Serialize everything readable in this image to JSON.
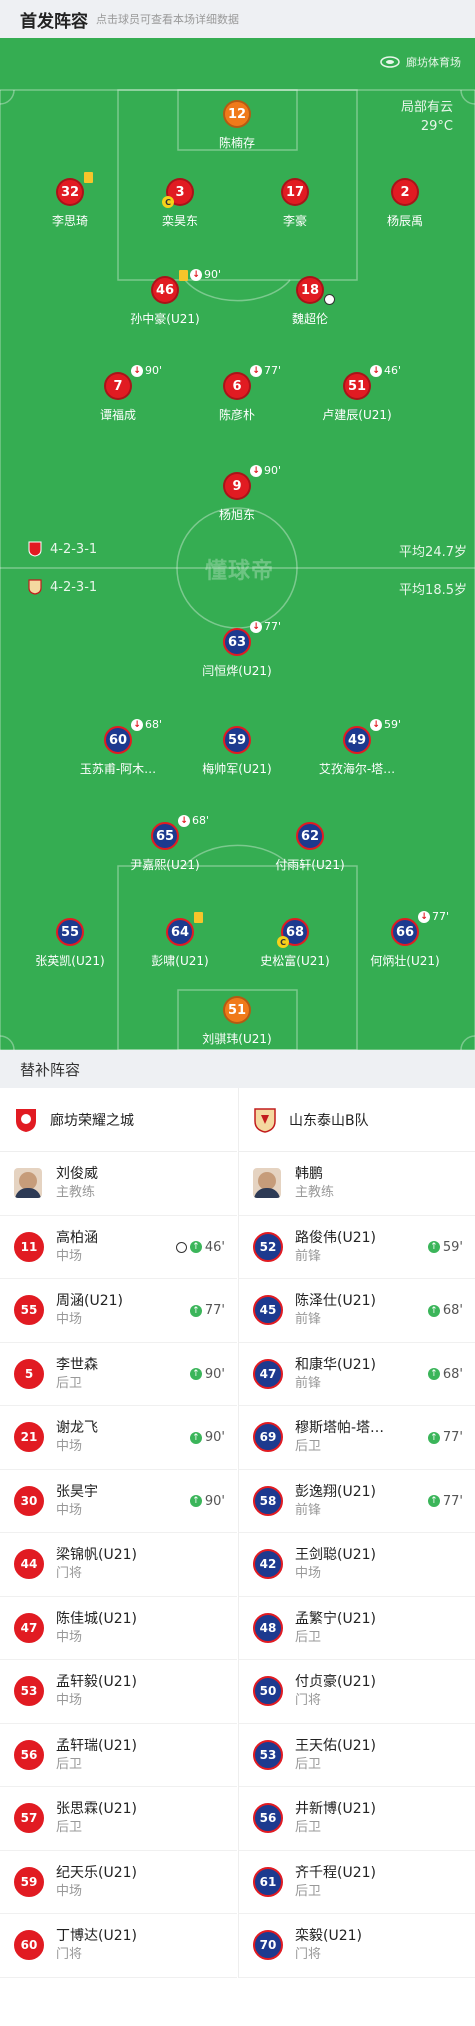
{
  "header": {
    "title": "首发阵容",
    "subtitle": "点击球员可查看本场详细数据"
  },
  "venue": "廊坊体育场",
  "weather": {
    "condition": "局部有云",
    "temp": "29°C"
  },
  "home": {
    "formation": "4-2-3-1",
    "avg_age": "平均24.7岁"
  },
  "away": {
    "formation": "4-2-3-1",
    "avg_age": "平均18.5岁"
  },
  "watermark": "懂球帝",
  "home_players": [
    {
      "num": "12",
      "name": "陈楠存",
      "color": "orange"
    },
    {
      "num": "32",
      "name": "李思琦",
      "color": "red",
      "yellow": true
    },
    {
      "num": "3",
      "name": "栾昊东",
      "color": "red",
      "captain": true
    },
    {
      "num": "17",
      "name": "李豪",
      "color": "red"
    },
    {
      "num": "2",
      "name": "杨辰禹",
      "color": "red"
    },
    {
      "num": "46",
      "name": "孙中豪(U21)",
      "color": "red",
      "yellow": true,
      "sub_out": "90'"
    },
    {
      "num": "18",
      "name": "魏超伦",
      "color": "red",
      "goal": true
    },
    {
      "num": "7",
      "name": "谭福成",
      "color": "red",
      "sub_out": "90'"
    },
    {
      "num": "6",
      "name": "陈彦朴",
      "color": "red",
      "sub_out": "77'"
    },
    {
      "num": "51",
      "name": "卢建辰(U21)",
      "color": "red",
      "sub_out": "46'"
    },
    {
      "num": "9",
      "name": "杨旭东",
      "color": "red",
      "sub_out": "90'"
    }
  ],
  "away_players": [
    {
      "num": "63",
      "name": "闫恒烨(U21)",
      "color": "blue",
      "sub_out": "77'"
    },
    {
      "num": "60",
      "name": "玉苏甫-阿木…",
      "color": "blue",
      "sub_out": "68'"
    },
    {
      "num": "59",
      "name": "梅帅军(U21)",
      "color": "blue"
    },
    {
      "num": "49",
      "name": "艾孜海尔-塔…",
      "color": "blue",
      "sub_out": "59'"
    },
    {
      "num": "65",
      "name": "尹嘉熙(U21)",
      "color": "blue",
      "sub_out": "68'"
    },
    {
      "num": "62",
      "name": "付雨轩(U21)",
      "color": "blue"
    },
    {
      "num": "55",
      "name": "张英凯(U21)",
      "color": "blue"
    },
    {
      "num": "64",
      "name": "彭啸(U21)",
      "color": "blue",
      "yellow": true
    },
    {
      "num": "68",
      "name": "史松富(U21)",
      "color": "blue",
      "captain": true
    },
    {
      "num": "66",
      "name": "何炳壮(U21)",
      "color": "blue",
      "sub_out": "77'"
    },
    {
      "num": "51",
      "name": "刘骐玮(U21)",
      "color": "orange"
    }
  ],
  "subs": {
    "title": "替补阵容",
    "home_team": "廊坊荣耀之城",
    "away_team": "山东泰山B队",
    "home_coach": {
      "name": "刘俊威",
      "role": "主教练"
    },
    "away_coach": {
      "name": "韩鹏",
      "role": "主教练"
    },
    "home": [
      {
        "num": "11",
        "name": "高柏涵",
        "pos": "中场",
        "time": "46'",
        "goal": true
      },
      {
        "num": "55",
        "name": "周涵(U21)",
        "pos": "中场",
        "time": "77'"
      },
      {
        "num": "5",
        "name": "李世森",
        "pos": "后卫",
        "time": "90'"
      },
      {
        "num": "21",
        "name": "谢龙飞",
        "pos": "中场",
        "time": "90'"
      },
      {
        "num": "30",
        "name": "张昊宇",
        "pos": "中场",
        "time": "90'"
      },
      {
        "num": "44",
        "name": "梁锦帆(U21)",
        "pos": "门将"
      },
      {
        "num": "47",
        "name": "陈佳城(U21)",
        "pos": "中场"
      },
      {
        "num": "53",
        "name": "孟轩毅(U21)",
        "pos": "中场"
      },
      {
        "num": "56",
        "name": "孟轩瑞(U21)",
        "pos": "后卫"
      },
      {
        "num": "57",
        "name": "张思霖(U21)",
        "pos": "后卫"
      },
      {
        "num": "59",
        "name": "纪天乐(U21)",
        "pos": "中场"
      },
      {
        "num": "60",
        "name": "丁博达(U21)",
        "pos": "门将"
      }
    ],
    "away": [
      {
        "num": "52",
        "name": "路俊伟(U21)",
        "pos": "前锋",
        "time": "59'"
      },
      {
        "num": "45",
        "name": "陈泽仕(U21)",
        "pos": "前锋",
        "time": "68'"
      },
      {
        "num": "47",
        "name": "和康华(U21)",
        "pos": "前锋",
        "time": "68'"
      },
      {
        "num": "69",
        "name": "穆斯塔帕-塔…",
        "pos": "后卫",
        "time": "77'"
      },
      {
        "num": "58",
        "name": "彭逸翔(U21)",
        "pos": "前锋",
        "time": "77'"
      },
      {
        "num": "42",
        "name": "王剑聪(U21)",
        "pos": "中场"
      },
      {
        "num": "48",
        "name": "孟繁宁(U21)",
        "pos": "后卫"
      },
      {
        "num": "50",
        "name": "付贞豪(U21)",
        "pos": "门将"
      },
      {
        "num": "53",
        "name": "王天佑(U21)",
        "pos": "后卫"
      },
      {
        "num": "56",
        "name": "井新博(U21)",
        "pos": "后卫"
      },
      {
        "num": "61",
        "name": "齐千程(U21)",
        "pos": "后卫"
      },
      {
        "num": "70",
        "name": "栾毅(U21)",
        "pos": "门将"
      }
    ]
  },
  "colors": {
    "pitch": "#35ad52",
    "red": "#e11b22",
    "blue": "#1d3a8f",
    "orange": "#f07a1a"
  }
}
